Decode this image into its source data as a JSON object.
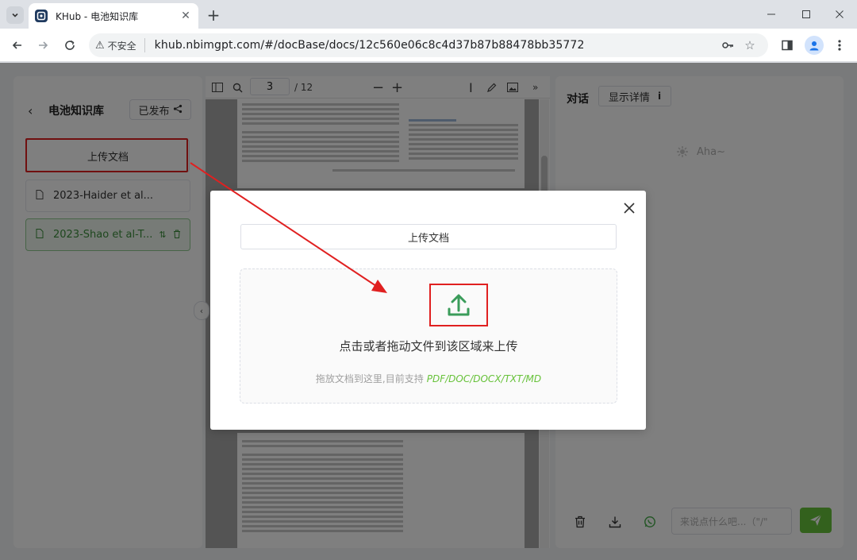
{
  "browser": {
    "tab_title": "KHub - 电池知识库",
    "security_label": "不安全",
    "url": "khub.nbimgpt.com/#/docBase/docs/12c560e06c8c4d37b87b88478bb35772"
  },
  "sidebar": {
    "title": "电池知识库",
    "publish_label": "已发布",
    "upload_label": "上传文档",
    "docs": [
      {
        "label": "2023-Haider et al..."
      },
      {
        "label": "2023-Shao et al-T..."
      }
    ]
  },
  "viewer": {
    "current_page": "3",
    "total_pages": "/ 12"
  },
  "chat": {
    "title": "对话",
    "detail_label": "显示详情",
    "detail_icon": "i",
    "placeholder_text": "Aha~",
    "input_placeholder": "来说点什么吧...（\"/\"",
    "accent_color": "#67c23a"
  },
  "modal": {
    "upload_button_label": "上传文档",
    "drop_main": "点击或者拖动文件到该区域来上传",
    "drop_sub": "拖放文档到这里,目前支持",
    "drop_types": "PDF/DOC/DOCX/TXT/MD"
  }
}
